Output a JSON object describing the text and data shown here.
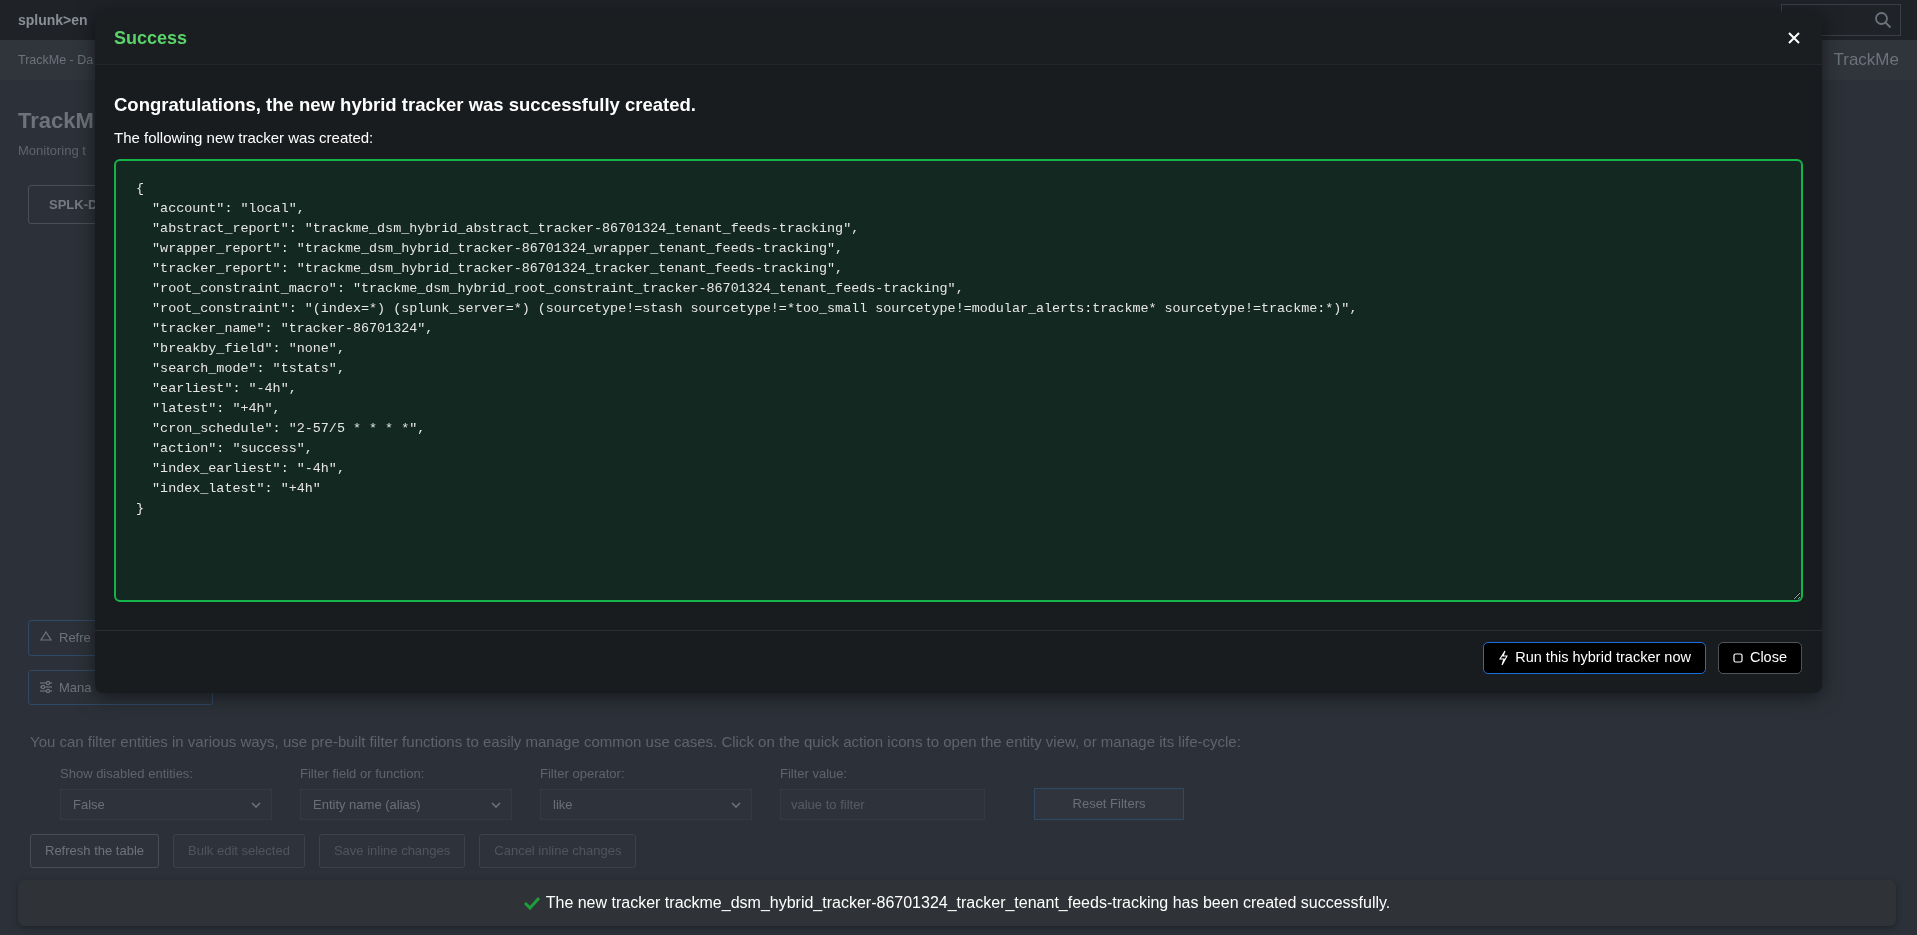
{
  "background": {
    "logo": "splunk>en",
    "app_nav": "TrackMe - Da",
    "app_name": "TrackMe",
    "title": "TrackM",
    "subtitle": "Monitoring t",
    "tab": "SPLK-D",
    "action_buttons": [
      {
        "label": "Refre",
        "kind": "refresh"
      },
      {
        "label": "Mana",
        "kind": "manage"
      }
    ],
    "filter_intro": "You can filter entities in various ways, use pre-built filter functions to easily manage common use cases. Click on the quick action icons to open the entity view, or manage its life-cycle:",
    "filters": [
      {
        "label": "Show disabled entities:",
        "kind": "select",
        "value": "False"
      },
      {
        "label": "Filter field or function:",
        "kind": "select",
        "value": "Entity name (alias)"
      },
      {
        "label": "Filter operator:",
        "kind": "select",
        "value": "like"
      },
      {
        "label": "Filter value:",
        "kind": "input",
        "placeholder": "value to filter"
      }
    ],
    "reset_button": "Reset Filters",
    "table_buttons": [
      {
        "label": "Refresh the table",
        "disabled": false
      },
      {
        "label": "Bulk edit selected",
        "disabled": true
      },
      {
        "label": "Save inline changes",
        "disabled": true
      },
      {
        "label": "Cancel inline changes",
        "disabled": true
      }
    ]
  },
  "modal": {
    "title": "Success",
    "heading": "Congratulations, the new hybrid tracker was successfully created.",
    "subheading": "The following new tracker was created:",
    "tracker_json": "{\n  \"account\": \"local\",\n  \"abstract_report\": \"trackme_dsm_hybrid_abstract_tracker-86701324_tenant_feeds-tracking\",\n  \"wrapper_report\": \"trackme_dsm_hybrid_tracker-86701324_wrapper_tenant_feeds-tracking\",\n  \"tracker_report\": \"trackme_dsm_hybrid_tracker-86701324_tracker_tenant_feeds-tracking\",\n  \"root_constraint_macro\": \"trackme_dsm_hybrid_root_constraint_tracker-86701324_tenant_feeds-tracking\",\n  \"root_constraint\": \"(index=*) (splunk_server=*) (sourcetype!=stash sourcetype!=*too_small sourcetype!=modular_alerts:trackme* sourcetype!=trackme:*)\",\n  \"tracker_name\": \"tracker-86701324\",\n  \"breakby_field\": \"none\",\n  \"search_mode\": \"tstats\",\n  \"earliest\": \"-4h\",\n  \"latest\": \"+4h\",\n  \"cron_schedule\": \"2-57/5 * * * *\",\n  \"action\": \"success\",\n  \"index_earliest\": \"-4h\",\n  \"index_latest\": \"+4h\"\n}",
    "buttons": [
      {
        "label": "Run this hybrid tracker now",
        "kind": "run"
      },
      {
        "label": "Close",
        "kind": "close"
      }
    ]
  },
  "toast": {
    "message": "The new tracker trackme_dsm_hybrid_tracker-86701324_tracker_tenant_feeds-tracking has been created successfully."
  }
}
